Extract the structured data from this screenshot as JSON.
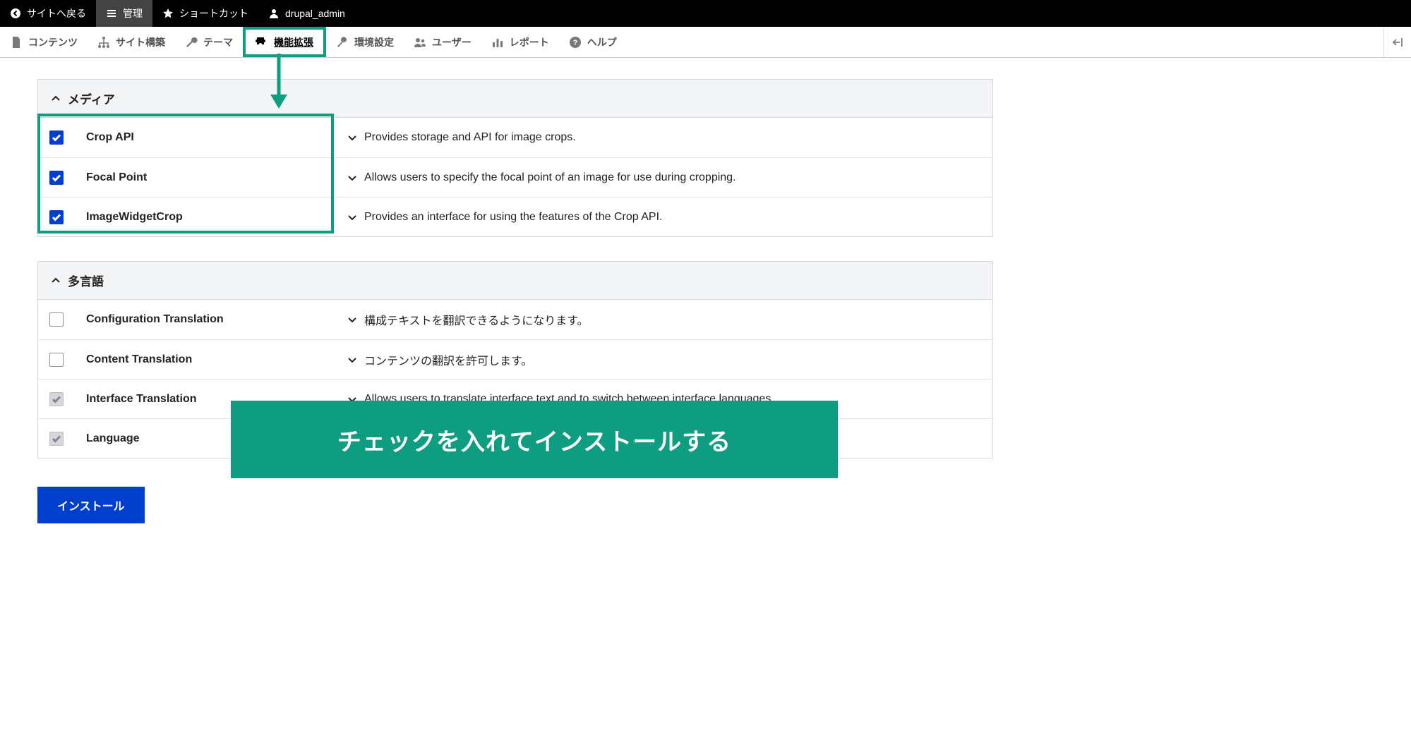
{
  "topbar": {
    "back": "サイトへ戻る",
    "manage": "管理",
    "shortcut": "ショートカット",
    "user": "drupal_admin"
  },
  "adminbar": {
    "content": "コンテンツ",
    "structure": "サイト構築",
    "appearance": "テーマ",
    "extend": "機能拡張",
    "config": "環境設定",
    "people": "ユーザー",
    "reports": "レポート",
    "help": "ヘルプ"
  },
  "sections": {
    "media": {
      "title": "メディア",
      "rows": [
        {
          "name": "Crop API",
          "desc": "Provides storage and API for image crops.",
          "checked": true,
          "disabled": false
        },
        {
          "name": "Focal Point",
          "desc": "Allows users to specify the focal point of an image for use during cropping.",
          "checked": true,
          "disabled": false
        },
        {
          "name": "ImageWidgetCrop",
          "desc": "Provides an interface for using the features of the Crop API.",
          "checked": true,
          "disabled": false
        }
      ]
    },
    "multilang": {
      "title": "多言語",
      "rows": [
        {
          "name": "Configuration Translation",
          "desc": "構成テキストを翻訳できるようになります。",
          "checked": false,
          "disabled": false
        },
        {
          "name": "Content Translation",
          "desc": "コンテンツの翻訳を許可します。",
          "checked": false,
          "disabled": false
        },
        {
          "name": "Interface Translation",
          "desc": "Allows users to translate interface text and to switch between interface languages.",
          "checked": true,
          "disabled": true
        },
        {
          "name": "Language",
          "desc": "",
          "checked": true,
          "disabled": true
        }
      ]
    }
  },
  "install_btn": "インストール",
  "banner_text": "チェックを入れてインストールする"
}
